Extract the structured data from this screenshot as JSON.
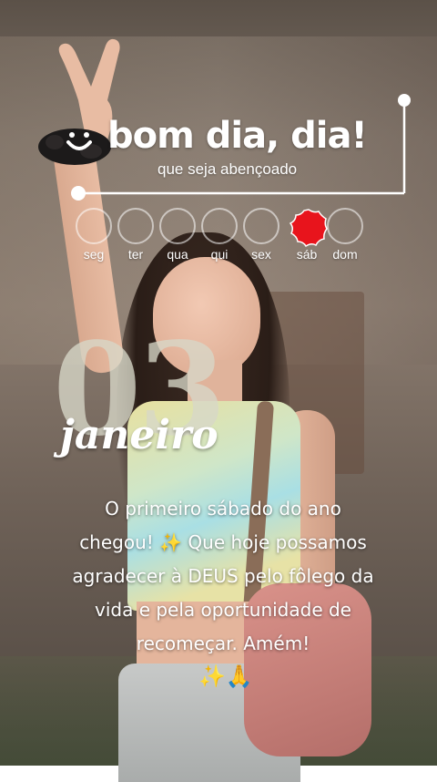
{
  "greeting": {
    "title": "bom dia, dia!",
    "subtitle": "que seja abençoado",
    "smile_icon": "smile-icon"
  },
  "weekdays": [
    {
      "label": "seg",
      "active": false
    },
    {
      "label": "ter",
      "active": false
    },
    {
      "label": "qua",
      "active": false
    },
    {
      "label": "qui",
      "active": false
    },
    {
      "label": "sex",
      "active": false
    },
    {
      "label": "sáb",
      "active": true
    },
    {
      "label": "dom",
      "active": false
    }
  ],
  "date": {
    "day": "03",
    "month": "janeiro"
  },
  "message": {
    "lines": [
      "O primeiro sábado do ano",
      "chegou! ✨ Que hoje possamos",
      "agradecer à DEUS pelo fôlego da",
      "vida e pela oportunidade de",
      "recomeçar. Amém!"
    ],
    "emoji": "✨🙏"
  },
  "colors": {
    "accent": "#e8141c",
    "text": "#ffffff",
    "bignum": "#d7d7c8"
  }
}
